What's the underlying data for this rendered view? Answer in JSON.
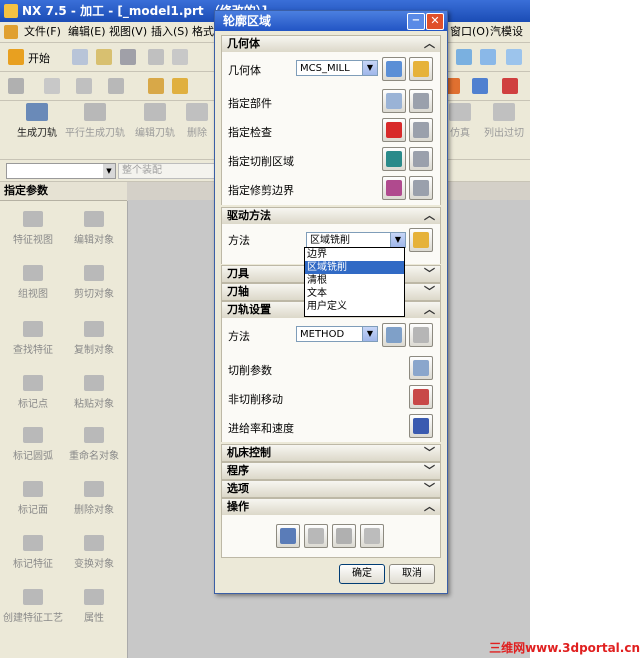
{
  "window_title": "NX 7.5 - 加工 - [_model1.prt （修改的）]",
  "menubar": {
    "items": [
      "文件(F)",
      "编辑(E)",
      "视图(V)",
      "插入(S)",
      "格式",
      "窗口(O)",
      "汽模设计"
    ]
  },
  "toolbar": {
    "start_label": "开始"
  },
  "ribbon": {
    "buttons": [
      {
        "label": "生成刀轨",
        "enabled": true
      },
      {
        "label": "平行生成刀轨",
        "enabled": false
      },
      {
        "label": "编辑刀轨",
        "enabled": false
      },
      {
        "label": "删除",
        "enabled": false
      },
      {
        "label": "仿真",
        "enabled": false
      },
      {
        "label": "列出过切",
        "enabled": false
      }
    ]
  },
  "filter": {
    "value": "整个装配"
  },
  "left_panel": {
    "header": "指定参数",
    "col1": [
      "特征视图",
      "组视图",
      "查找特征",
      "标记点",
      "标记圆弧",
      "标记面",
      "标记特征",
      "创建特征工艺"
    ],
    "col2": [
      "编辑对象",
      "剪切对象",
      "复制对象",
      "粘贴对象",
      "重命名对象",
      "删除对象",
      "变换对象",
      "属性"
    ]
  },
  "dialog": {
    "title": "轮廓区域",
    "sections": {
      "geometry": {
        "label": "几何体",
        "geometry_label": "几何体",
        "geometry_value": "MCS_MILL",
        "rows": [
          "指定部件",
          "指定检查",
          "指定切削区域",
          "指定修剪边界"
        ]
      },
      "drive": {
        "label": "驱动方法",
        "method_label": "方法",
        "method_value": "区域铣削",
        "options": [
          "边界",
          "区域铣削",
          "清根",
          "文本",
          "用户定义"
        ],
        "selected_index": 1
      },
      "tool": {
        "label": "刀具"
      },
      "axis": {
        "label": "刀轴"
      },
      "path": {
        "label": "刀轨设置",
        "method_label": "方法",
        "method_value": "METHOD",
        "rows": [
          "切削参数",
          "非切削移动",
          "进给率和速度"
        ]
      },
      "machine": {
        "label": "机床控制"
      },
      "program": {
        "label": "程序"
      },
      "options": {
        "label": "选项"
      },
      "actions": {
        "label": "操作"
      }
    },
    "ok_label": "确定",
    "cancel_label": "取消"
  },
  "watermark": "三维网www.3dportal.cn"
}
